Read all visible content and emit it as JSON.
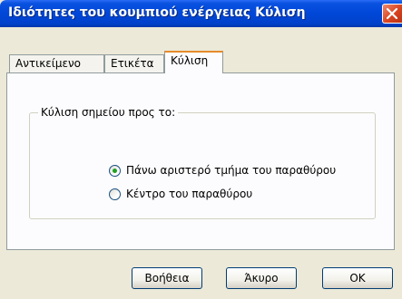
{
  "window": {
    "title": "Ιδιότητες του κουμπιού ενέργειας Κύλιση"
  },
  "tabs": [
    {
      "label": "Αντικείμενο",
      "active": false
    },
    {
      "label": "Ετικέτα",
      "active": false
    },
    {
      "label": "Κύλιση",
      "active": true
    }
  ],
  "group": {
    "legend": "Κύλιση σημείου προς το:",
    "options": [
      {
        "label": "Πάνω αριστερό τμήμα του παραθύρου",
        "selected": true
      },
      {
        "label": "Κέντρο του παραθύρου",
        "selected": false
      }
    ]
  },
  "buttons": {
    "help": "Βοήθεια",
    "cancel": "Άκυρο",
    "ok": "OK"
  },
  "colors": {
    "titlebar": "#0047d8",
    "active_tab_accent": "#e68b2c",
    "radio_dot": "#21a121"
  }
}
